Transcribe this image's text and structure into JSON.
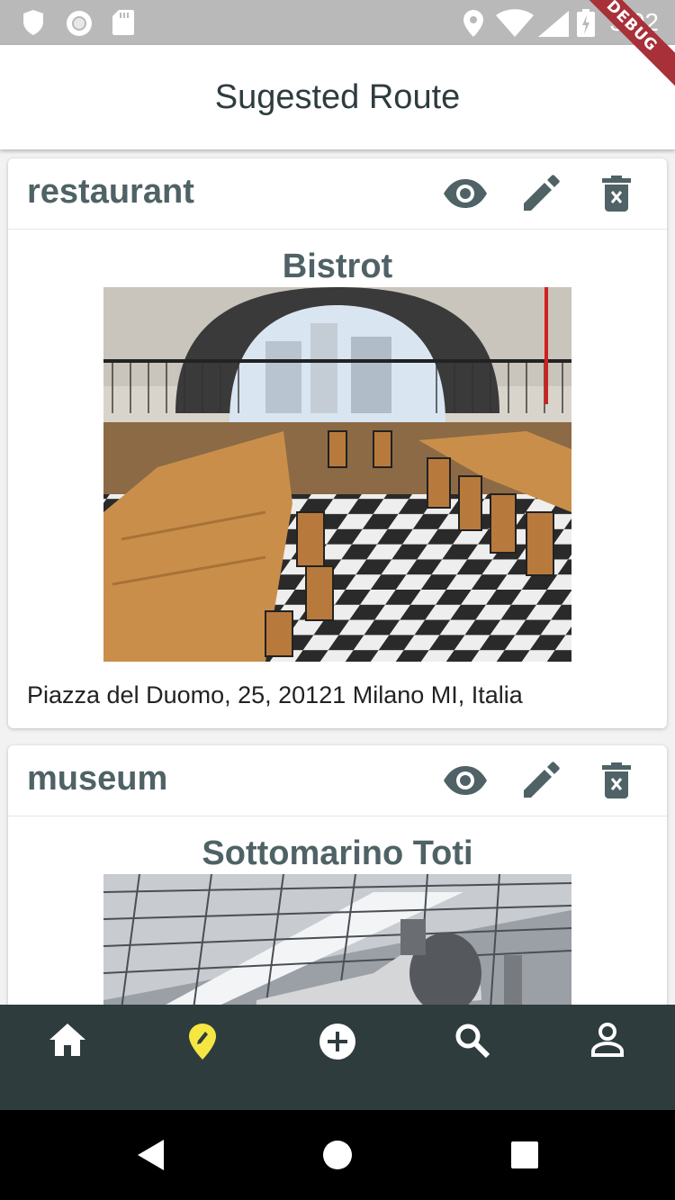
{
  "status_bar": {
    "time": "3:02",
    "debug_label": "DEBUG",
    "icons": [
      "shield-icon",
      "circle-notification-icon",
      "sd-card-icon",
      "location-icon",
      "wifi-icon",
      "signal-icon",
      "battery-icon"
    ]
  },
  "app_bar": {
    "title": "Sugested Route"
  },
  "cards": [
    {
      "category": "restaurant",
      "name": "Bistrot",
      "address": "Piazza del Duomo, 25, 20121 Milano MI, Italia",
      "image": "restaurant-interior-photo"
    },
    {
      "category": "museum",
      "name": "Sottomarino Toti",
      "address": "",
      "image": "museum-train-hall-photo"
    }
  ],
  "card_actions": [
    "view-icon",
    "edit-icon",
    "delete-icon"
  ],
  "bottom_nav": {
    "items": [
      "home",
      "route",
      "add",
      "search",
      "profile"
    ],
    "active": "route",
    "active_color": "#f5e642",
    "inactive_color": "#ffffff"
  },
  "colors": {
    "app_bar_title": "#2e3c3e",
    "card_title": "#4f6266",
    "bottom_nav_bg": "#2e3c3e"
  }
}
